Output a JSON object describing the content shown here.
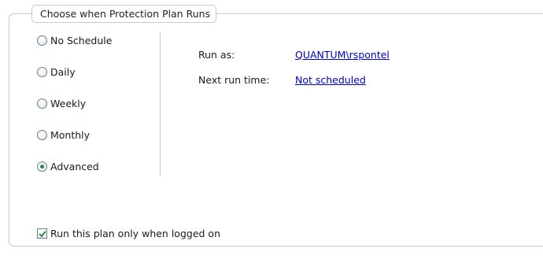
{
  "group": {
    "title": "Choose when Protection Plan Runs"
  },
  "schedule_options": [
    {
      "label": "No Schedule",
      "selected": false
    },
    {
      "label": "Daily",
      "selected": false
    },
    {
      "label": "Weekly",
      "selected": false
    },
    {
      "label": "Monthly",
      "selected": false
    },
    {
      "label": "Advanced",
      "selected": true
    }
  ],
  "details": {
    "run_as_label": "Run as:",
    "run_as_value": "QUANTUM\\rspontel",
    "next_run_label": "Next run time:",
    "next_run_value": "Not scheduled"
  },
  "logged_on_option": {
    "label": "Run this plan only when logged on",
    "checked": true
  },
  "colors": {
    "link": "#0000d0",
    "check_mark": "#2e8b3c",
    "border": "#c9c9c9"
  }
}
